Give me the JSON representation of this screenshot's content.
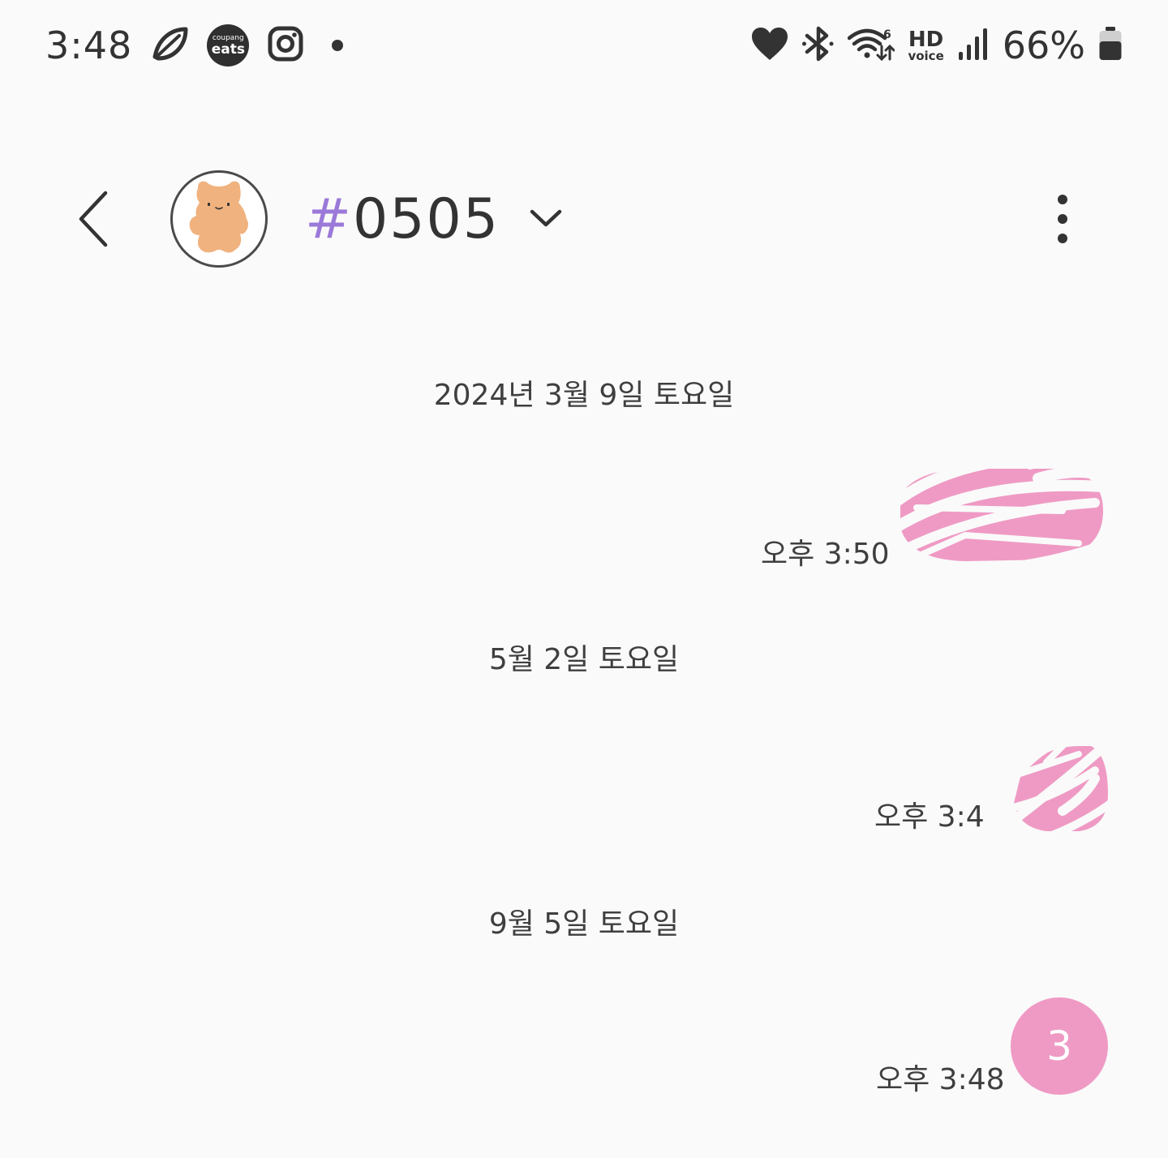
{
  "status_bar": {
    "time": "3:48",
    "coupang_small": "coupang",
    "coupang_big": "eats",
    "hd": "HD",
    "voice": "voice",
    "battery": "66%"
  },
  "header": {
    "hash": "#",
    "name": "0505",
    "hash_color": "#9b79d9"
  },
  "messages": [
    {
      "date": "2024년 3월 9일 토요일",
      "time": "오후 3:50"
    },
    {
      "date": "5월 2일 토요일",
      "time": "오후 3:4"
    },
    {
      "date": "9월 5일 토요일",
      "time": "오후 3:48",
      "bubble_text": "3"
    }
  ],
  "colors": {
    "bubble": "#ef9ac4",
    "background": "#fafafa"
  }
}
